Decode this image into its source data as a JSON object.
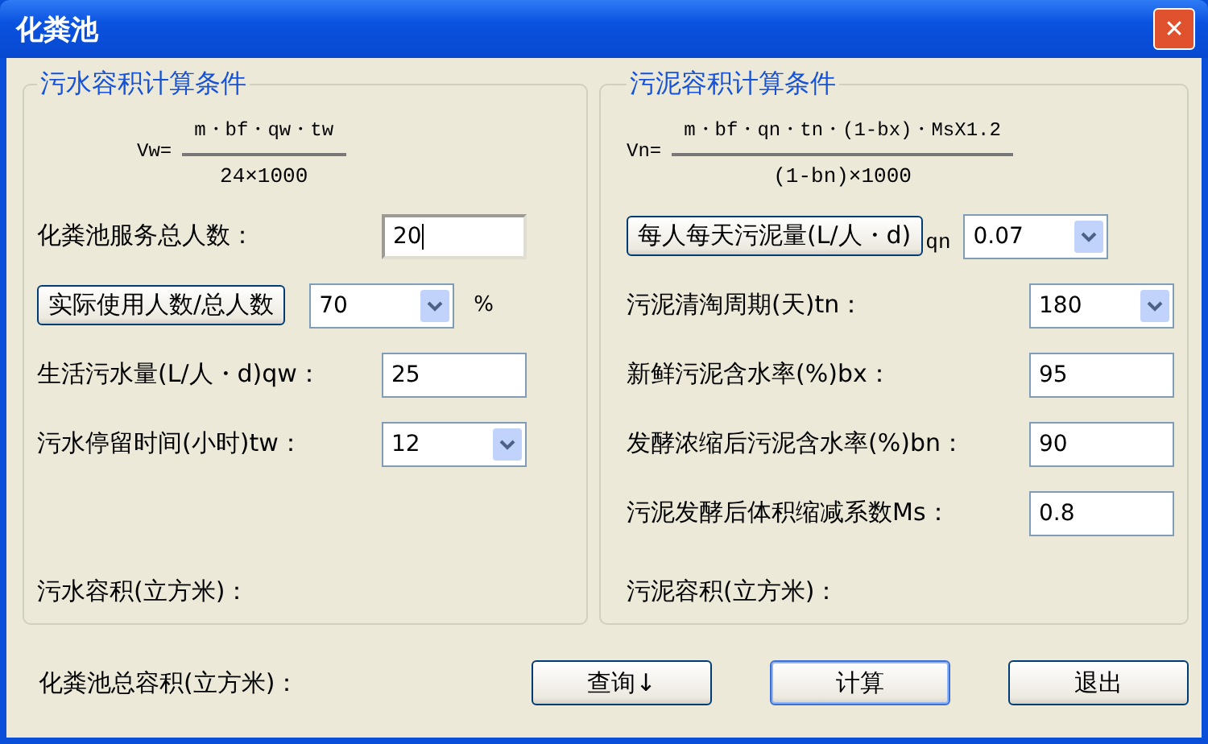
{
  "window": {
    "title": "化粪池",
    "close": "✕"
  },
  "sewage_group": {
    "title": "污水容积计算条件",
    "formula": {
      "lhs": "Vw=",
      "numerator": "m・bf・qw・tw",
      "denominator": "24×1000"
    },
    "fields": [
      {
        "kind": "text",
        "label": "化粪池服务总人数：",
        "value": "20",
        "focused": true
      },
      {
        "kind": "button-combo",
        "button": "实际使用人数/总人数",
        "value": "70",
        "unit": "%"
      },
      {
        "kind": "text",
        "label": "生活污水量(L/人・d)qw：",
        "value": "25",
        "focused": false
      },
      {
        "kind": "combo",
        "label": "污水停留时间(小时)tw：",
        "value": "12"
      }
    ],
    "result_label": "污水容积(立方米)："
  },
  "sludge_group": {
    "title": "污泥容积计算条件",
    "formula": {
      "lhs": "Vn=",
      "numerator": "m・bf・qn・tn・(1-bx)・MsX1.2",
      "denominator": "(1-bn)×1000"
    },
    "fields": [
      {
        "kind": "button-combo",
        "button": "每人每天污泥量(L/人・d)",
        "suffix": "qn",
        "value": "0.07"
      },
      {
        "kind": "combo",
        "label": "污泥清淘周期(天)tn：",
        "value": "180"
      },
      {
        "kind": "text",
        "label": "新鲜污泥含水率(%)bx：",
        "value": "95",
        "focused": false
      },
      {
        "kind": "text",
        "label": "发酵浓缩后污泥含水率(%)bn：",
        "value": "90",
        "focused": false
      },
      {
        "kind": "text",
        "label": "污泥发酵后体积缩减系数Ms：",
        "value": "0.8",
        "focused": false
      }
    ],
    "result_label": "污泥容积(立方米)："
  },
  "total_label": "化粪池总容积(立方米)：",
  "buttons": [
    {
      "label": "查询↓",
      "default": false
    },
    {
      "label": "计算",
      "default": true
    },
    {
      "label": "退出",
      "default": false
    }
  ]
}
